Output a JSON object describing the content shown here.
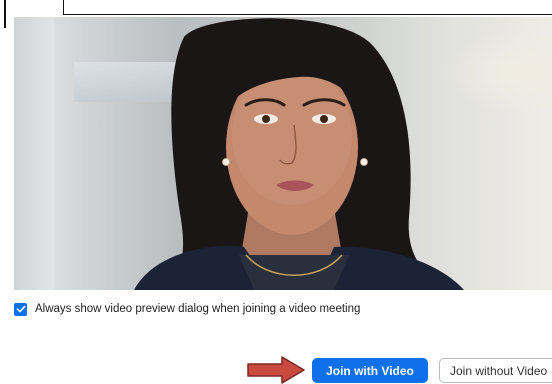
{
  "preview": {
    "image_description": "camera-preview"
  },
  "options": {
    "always_show_preview_label": "Always show video preview dialog when joining a video meeting",
    "always_show_preview_checked": true
  },
  "buttons": {
    "join_with_video": "Join with Video",
    "join_without_video": "Join without Video"
  },
  "colors": {
    "accent": "#0e71eb",
    "arrow": "#c94b3f"
  }
}
